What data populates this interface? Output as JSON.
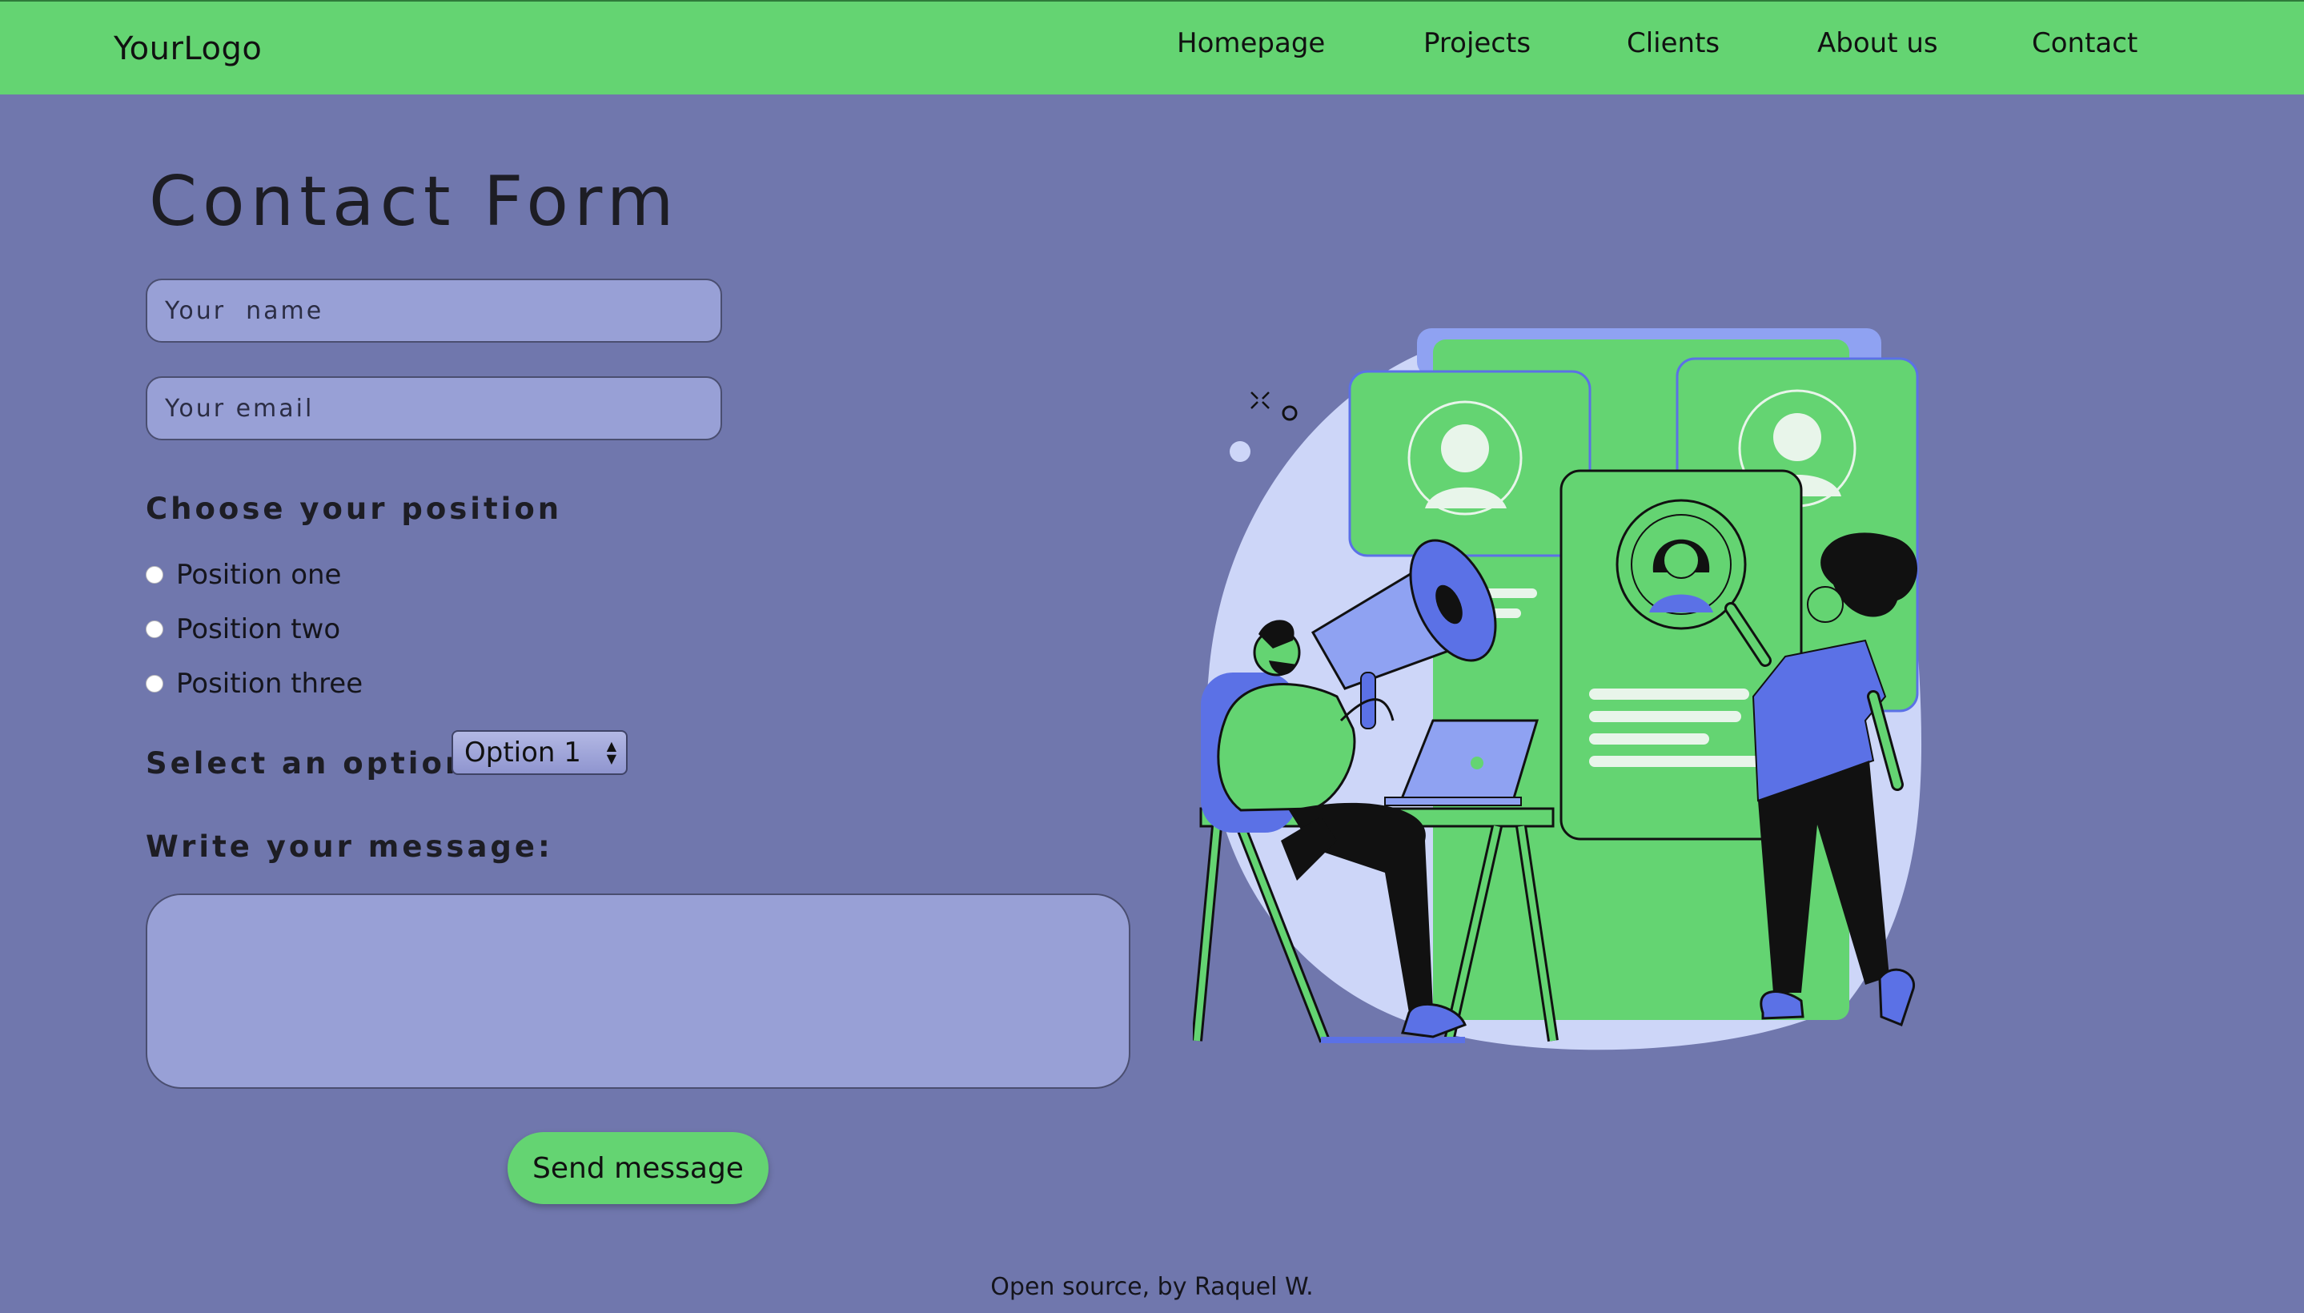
{
  "header": {
    "logo": "YourLogo",
    "nav": [
      "Homepage",
      "Projects",
      "Clients",
      "About us",
      "Contact"
    ]
  },
  "form": {
    "title": "Contact Form",
    "name_placeholder": "Your  name",
    "email_placeholder": "Your email",
    "position_label": "Choose your position",
    "positions": [
      "Position one",
      "Position two",
      "Position three"
    ],
    "select_label": "Select an option:",
    "select_value": "Option 1",
    "message_label": "Write your message:",
    "send_label": "Send message"
  },
  "footer": {
    "text": "Open source, by Raquel W."
  },
  "colors": {
    "header": "#64d472",
    "background": "#7077ad",
    "field": "#98a0d6",
    "button": "#64d472"
  }
}
